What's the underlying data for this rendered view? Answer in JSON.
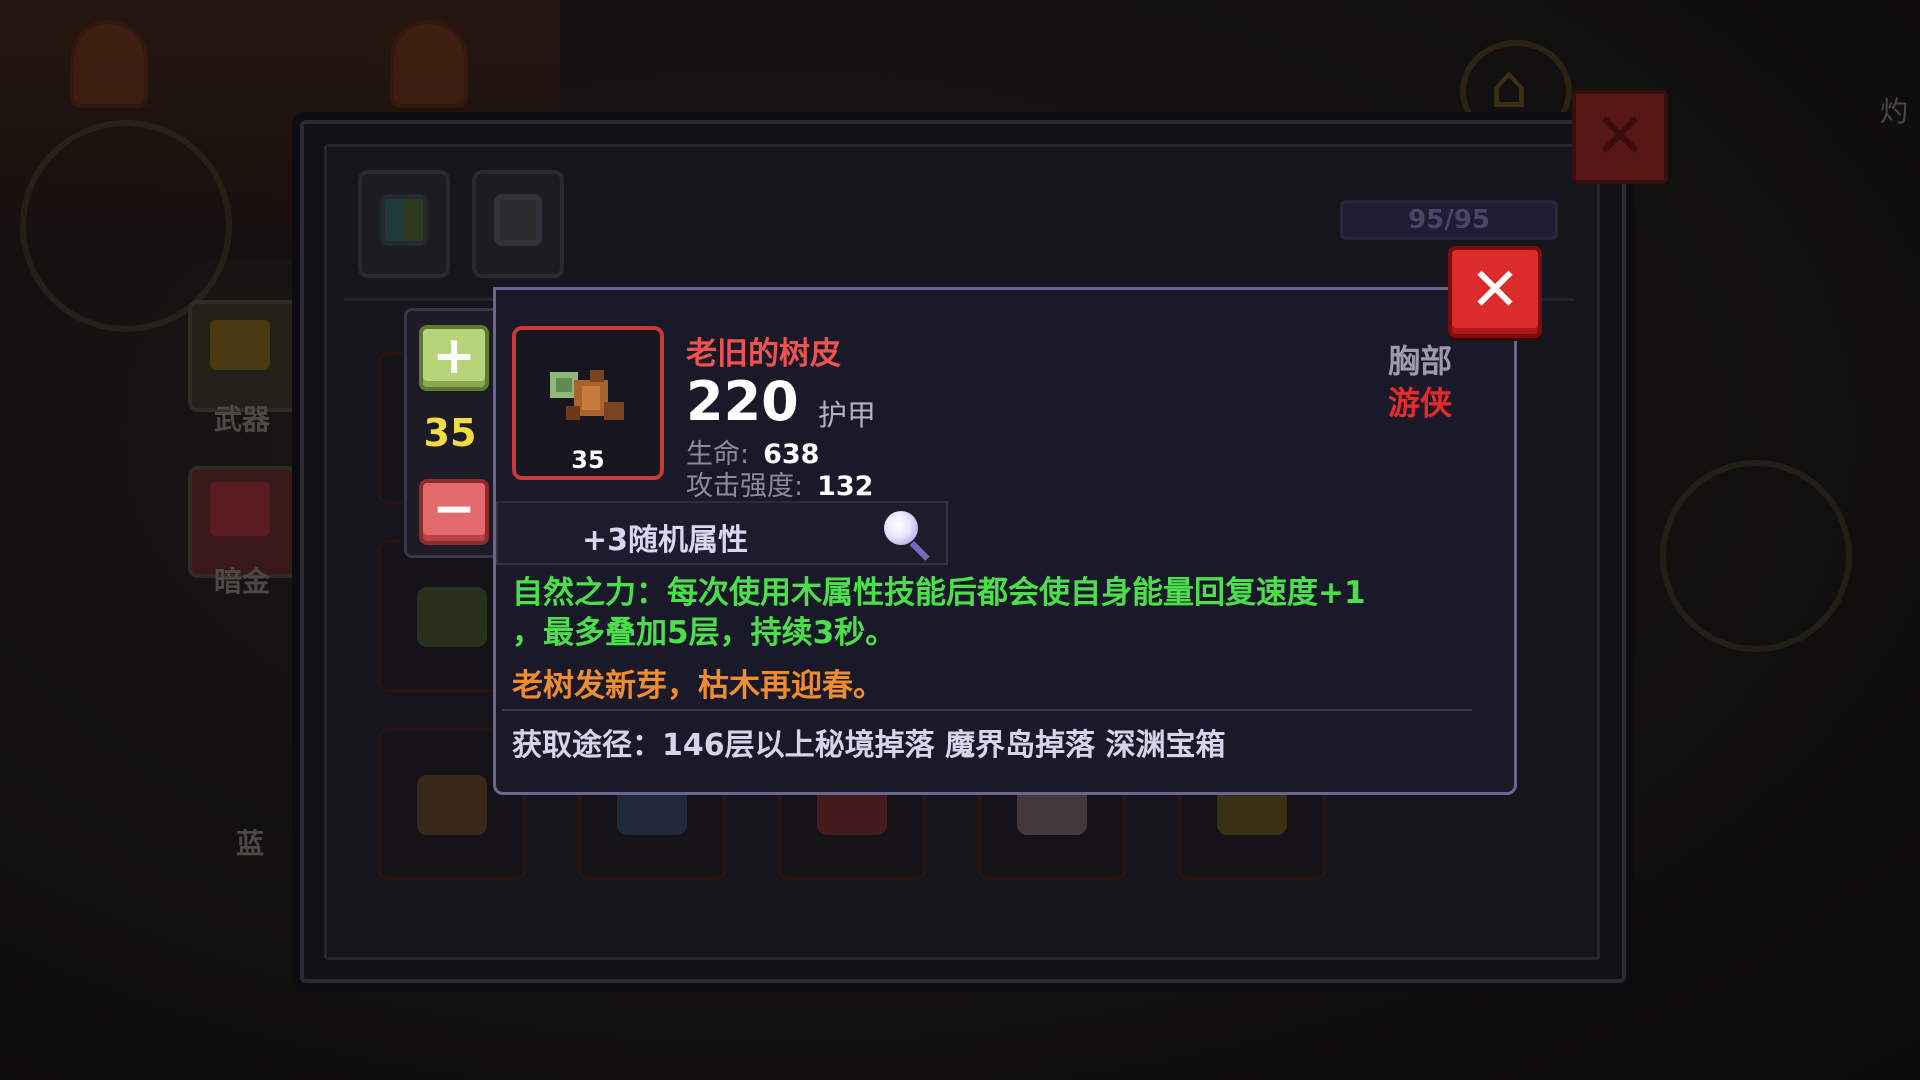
{
  "background": {
    "left_labels": [
      "武器",
      "暗金",
      "蓝"
    ],
    "right_label": "灼"
  },
  "inventory": {
    "tabs": [
      {
        "name": "all-items",
        "icon": "grid-icon"
      },
      {
        "name": "armor",
        "icon": "armor-icon"
      }
    ],
    "capacity": "95/95",
    "close_label": "✕"
  },
  "level_stepper": {
    "plus_label": "+",
    "level": "35",
    "minus_label": "−"
  },
  "tooltip": {
    "close_label": "✕",
    "item": {
      "name": "老旧的树皮",
      "level": "35",
      "armor_value": "220",
      "armor_label": "护甲",
      "slot": "胸部",
      "class": "游侠",
      "stats": [
        {
          "label": "生命:",
          "value": "638"
        },
        {
          "label": "攻击强度:",
          "value": "132"
        }
      ]
    },
    "random_attributes": "+3随机属性",
    "effect_line1": "自然之力：每次使用木属性技能后都会使自身能量回复速度+1",
    "effect_line2": "，最多叠加5层，持续3秒。",
    "flavor": "老树发新芽，枯木再迎春。",
    "source": "获取途径：146层以上秘境掉落 魔界岛掉落 深渊宝箱"
  },
  "colors": {
    "item_name": "#f05252",
    "class_name": "#e82a2a",
    "effect": "#4be04b",
    "flavor": "#f08c30",
    "level": "#f3dc40"
  }
}
